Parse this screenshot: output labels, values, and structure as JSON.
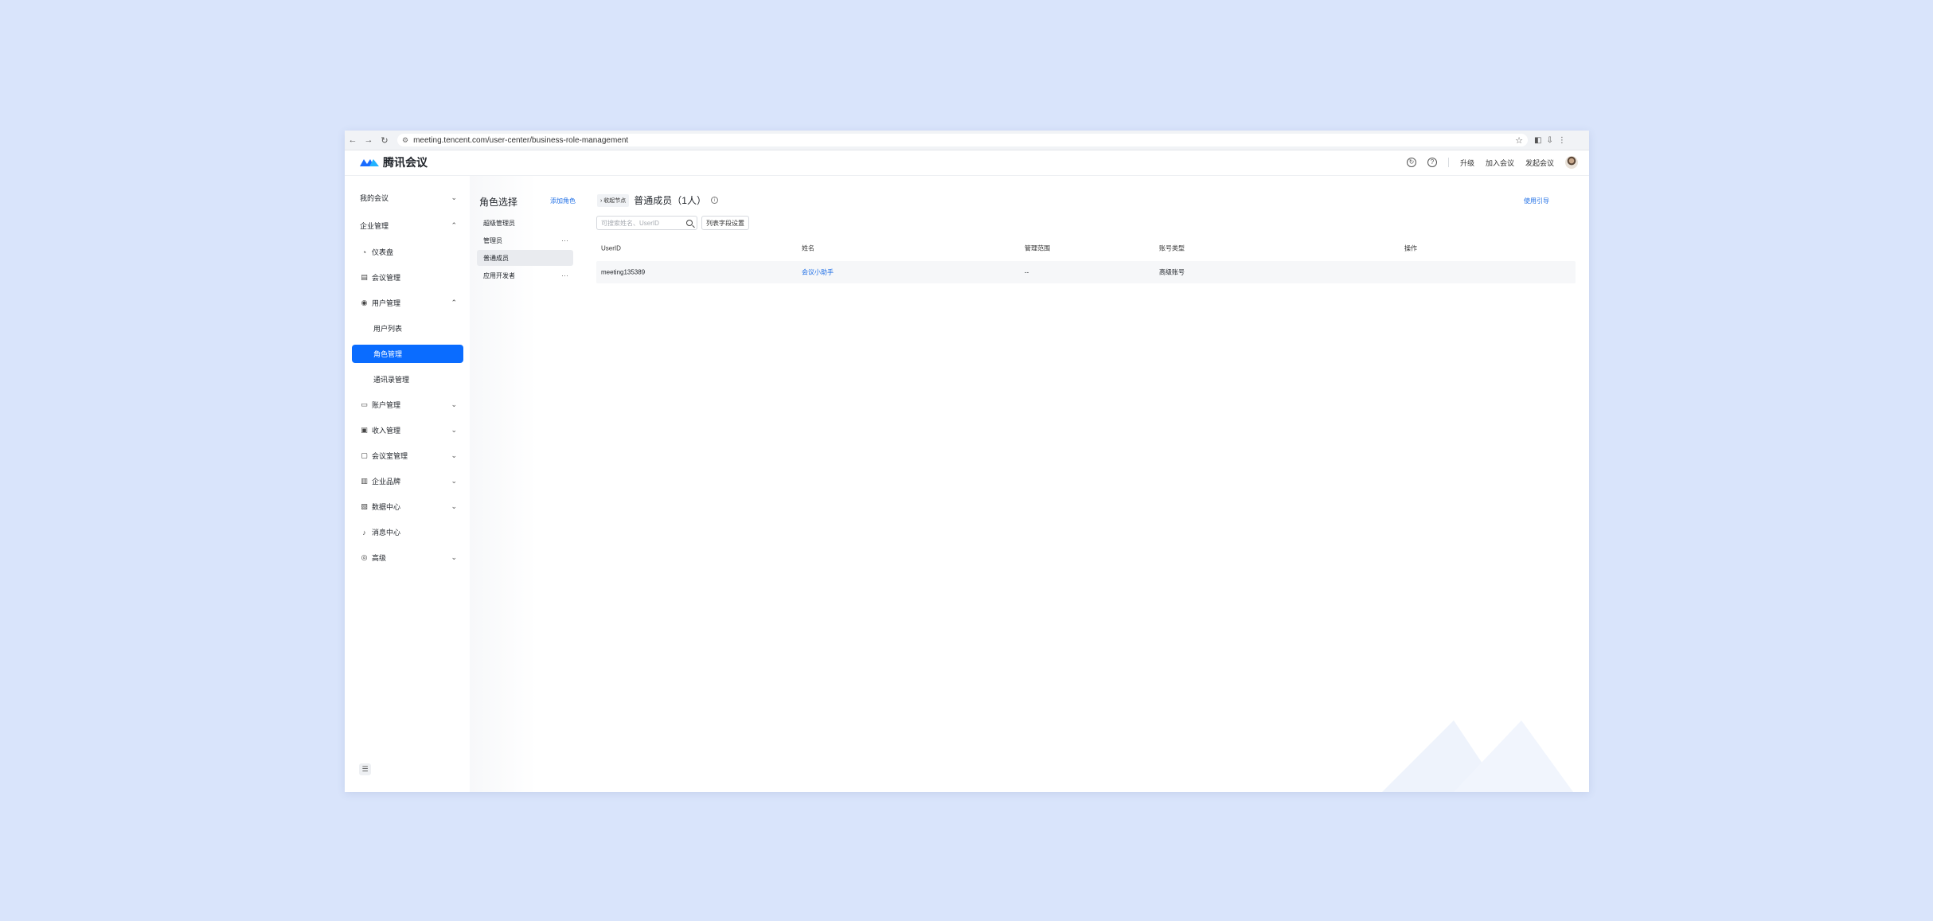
{
  "browser": {
    "url": "meeting.tencent.com/user-center/business-role-management",
    "nav": {
      "back": "←",
      "forward": "→",
      "reload": "↻"
    },
    "tune": "⚙",
    "star": "☆",
    "right": [
      "◧",
      "⇩",
      "⋮"
    ]
  },
  "header": {
    "brand": "腾讯会议",
    "actions": [
      "升级",
      "加入会议",
      "发起会议"
    ]
  },
  "sidenav": {
    "items": [
      {
        "label": "我的会议",
        "icon": "",
        "chevron": "⌄"
      },
      {
        "label": "企业管理",
        "icon": "",
        "chevron": "⌃"
      },
      {
        "label": "仪表盘",
        "icon": "◔"
      },
      {
        "label": "会议管理",
        "icon": "▤"
      },
      {
        "label": "用户管理",
        "icon": "◉",
        "chevron": "⌃"
      },
      {
        "label": "用户列表",
        "sub": true
      },
      {
        "label": "角色管理",
        "sub": true,
        "active": true
      },
      {
        "label": "通讯录管理",
        "sub": true
      },
      {
        "label": "账户管理",
        "icon": "▭",
        "chevron": "⌄"
      },
      {
        "label": "收入管理",
        "icon": "▣",
        "chevron": "⌄"
      },
      {
        "label": "会议室管理",
        "icon": "▢",
        "chevron": "⌄"
      },
      {
        "label": "企业品牌",
        "icon": "▥",
        "chevron": "⌄"
      },
      {
        "label": "数据中心",
        "icon": "▧",
        "chevron": "⌄"
      },
      {
        "label": "消息中心",
        "icon": "♪"
      },
      {
        "label": "高级",
        "icon": "◎",
        "chevron": "⌄"
      }
    ],
    "collapse_icon": "☰"
  },
  "roles": {
    "title": "角色选择",
    "add": "添加角色",
    "items": [
      {
        "label": "超级管理员"
      },
      {
        "label": "管理员",
        "more": "···"
      },
      {
        "label": "普通成员",
        "selected": true
      },
      {
        "label": "应用开发者",
        "more": "···"
      }
    ]
  },
  "main": {
    "collapse": "收起节点",
    "heading": "普通成员（1人）",
    "guide": "使用引导",
    "search_placeholder": "可搜索姓名、UserID",
    "column_settings": "列表字段设置",
    "columns": [
      "UserID",
      "姓名",
      "管理范围",
      "账号类型",
      "操作"
    ],
    "rows": [
      {
        "userid": "meeting135389",
        "name": "会议小助手",
        "scope": "--",
        "account_type": "高级账号",
        "ops": ""
      }
    ]
  }
}
